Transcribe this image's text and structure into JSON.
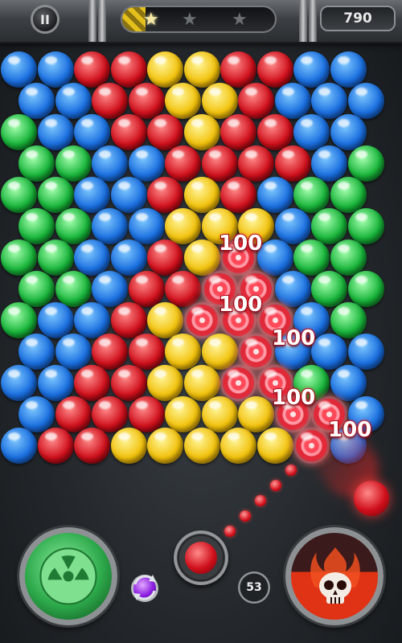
{
  "hud": {
    "pause_label": "II",
    "star_icons": [
      "★",
      "★",
      "★"
    ],
    "stars_earned": 1,
    "stars_total": 3,
    "star_progress_percent": 15,
    "score": "790"
  },
  "board": {
    "colors": {
      "b": "blue",
      "r": "red",
      "y": "yellow",
      "g": "green",
      "p": "popping-red"
    },
    "rows": [
      "bbrryyrrbb",
      "bbrryyrbbb",
      "gbbrryrrbb",
      "ggbbrrrrbg",
      "ggbbryrbgg",
      "ggbbyyybgg",
      "ggbbrypbgg",
      "ggbrrppbgg",
      "gbbrypppbg",
      "bbrryypbbb",
      "bbrryyppgb",
      "brrryyyppb",
      "brryyyyypb"
    ],
    "score_popups": [
      "100",
      "100",
      "100",
      "100",
      "100"
    ]
  },
  "controls": {
    "shots_left": "53",
    "current_bubble_color": "red",
    "next_bubble_color": "purple",
    "left_booster_icon": "radiation-icon",
    "right_booster_icon": "skull-icon"
  },
  "theme": {
    "blue": "#1a6fe0",
    "red": "#d0101c",
    "yellow": "#f2c20c",
    "green": "#18b53a",
    "purple": "#8a1ce0"
  }
}
